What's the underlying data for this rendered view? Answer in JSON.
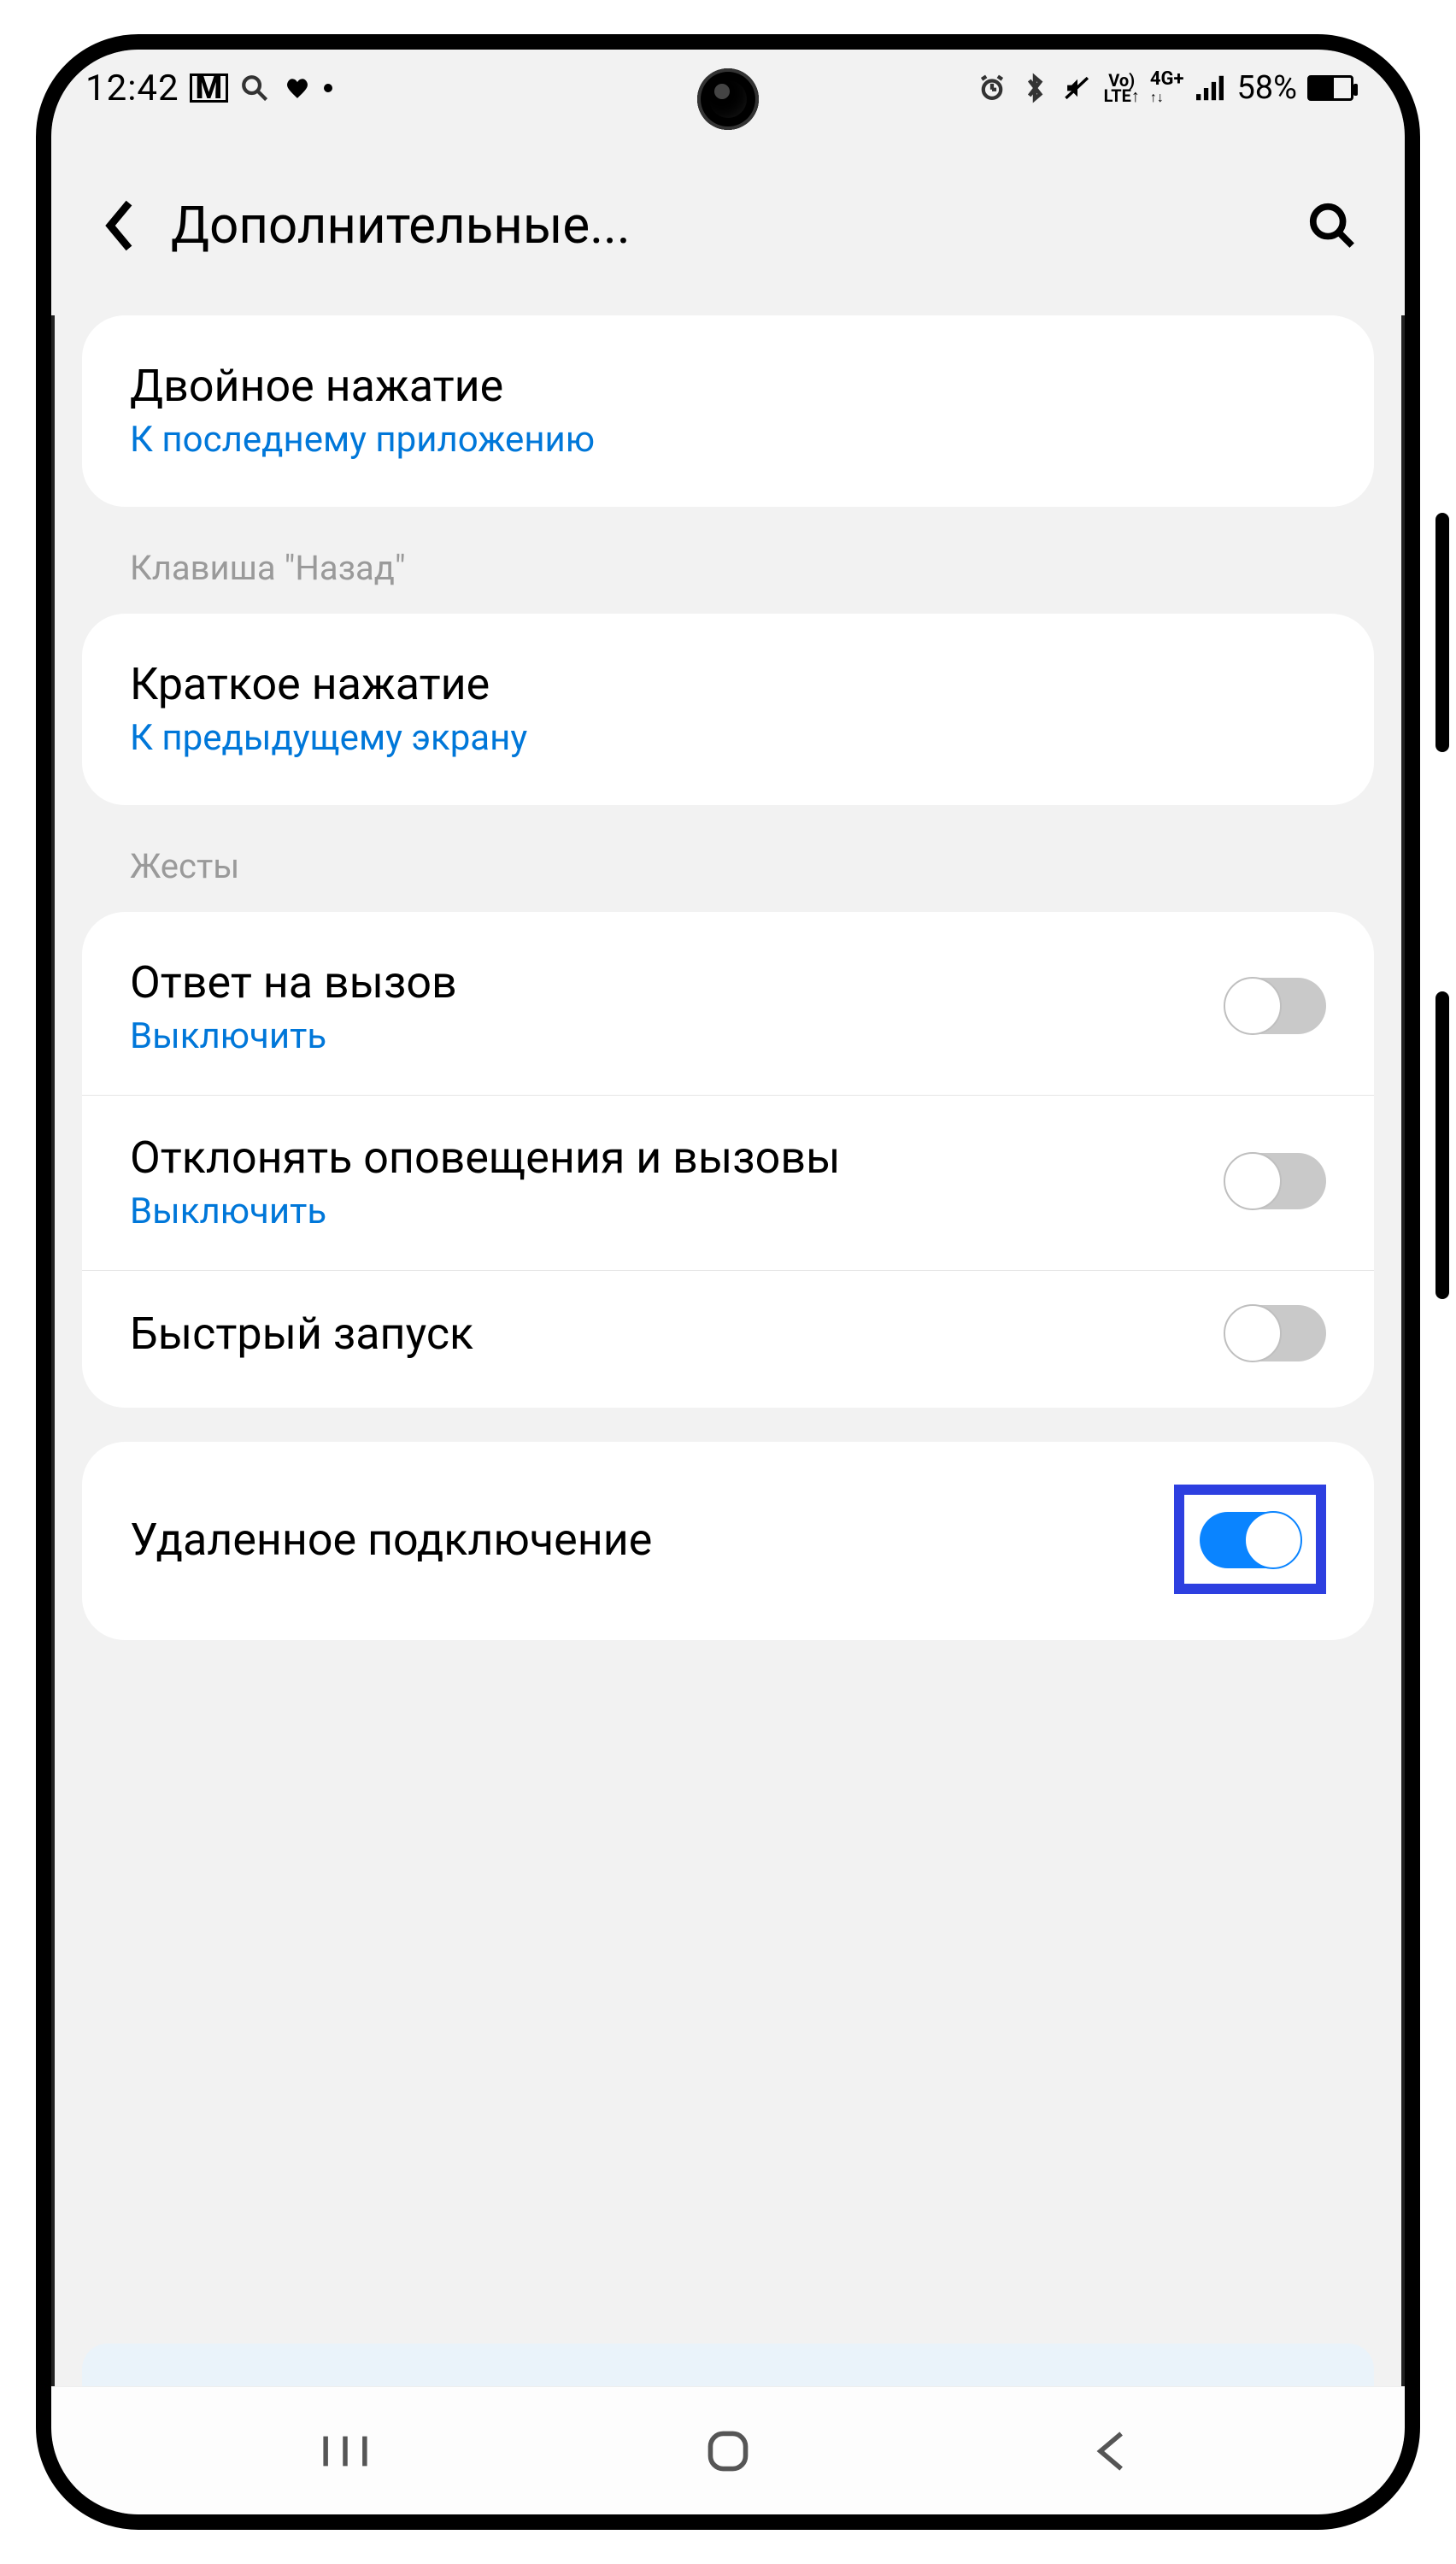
{
  "statusbar": {
    "time": "12:42",
    "battery_percent": "58%"
  },
  "header": {
    "title": "Дополнительные..."
  },
  "section1": {
    "items": [
      {
        "title": "Двойное нажатие",
        "sub": "К последнему приложению"
      }
    ]
  },
  "section2": {
    "label": "Клавиша \"Назад\"",
    "items": [
      {
        "title": "Краткое нажатие",
        "sub": "К предыдущему экрану"
      }
    ]
  },
  "section3": {
    "label": "Жесты",
    "items": [
      {
        "title": "Ответ на вызов",
        "sub": "Выключить",
        "toggle": false
      },
      {
        "title": "Отклонять оповещения и вызовы",
        "sub": "Выключить",
        "toggle": false
      },
      {
        "title": "Быстрый запуск",
        "toggle": false
      }
    ]
  },
  "section4": {
    "items": [
      {
        "title": "Удаленное подключение",
        "toggle": true,
        "highlight": true
      }
    ]
  }
}
